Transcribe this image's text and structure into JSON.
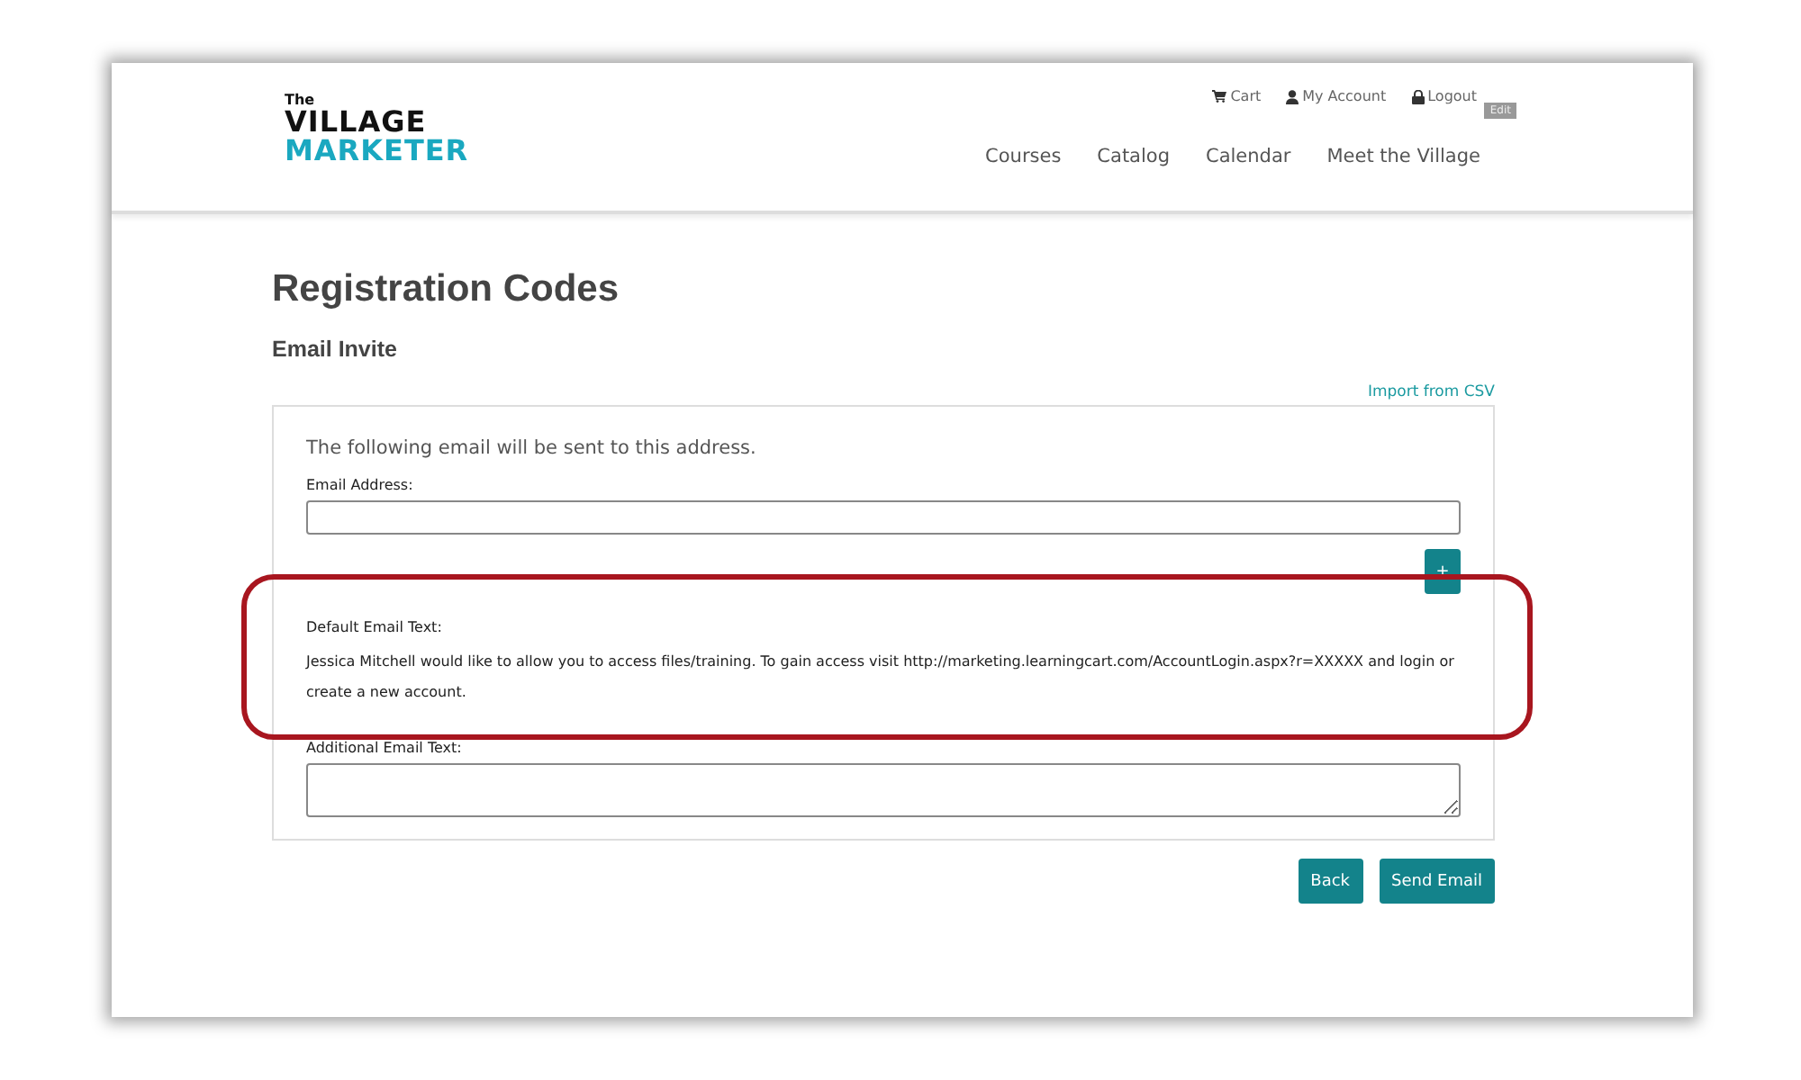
{
  "logo": {
    "small": "The",
    "line1": "VILLAGE",
    "line2": "MARKETER"
  },
  "top_links": [
    {
      "kind": "cart",
      "label": "Cart"
    },
    {
      "kind": "account",
      "label": "My Account"
    },
    {
      "kind": "logout",
      "label": "Logout"
    }
  ],
  "edit_badge": "Edit",
  "nav": [
    "Courses",
    "Catalog",
    "Calendar",
    "Meet the Village"
  ],
  "page_title": "Registration Codes",
  "subtitle": "Email Invite",
  "import_link": "Import from CSV",
  "form": {
    "intro": "The following email will be sent to this address.",
    "email_label": "Email Address:",
    "add_button": "+",
    "default_label": "Default Email Text:",
    "default_text": "Jessica Mitchell would like to allow you to access files/training. To gain access visit http://marketing.learningcart.com/AccountLogin.aspx?r=XXXXX and login or create a new account.",
    "default_highlighted": true,
    "additional_label": "Additional Email Text:"
  },
  "buttons": [
    "Back",
    "Send Email"
  ]
}
